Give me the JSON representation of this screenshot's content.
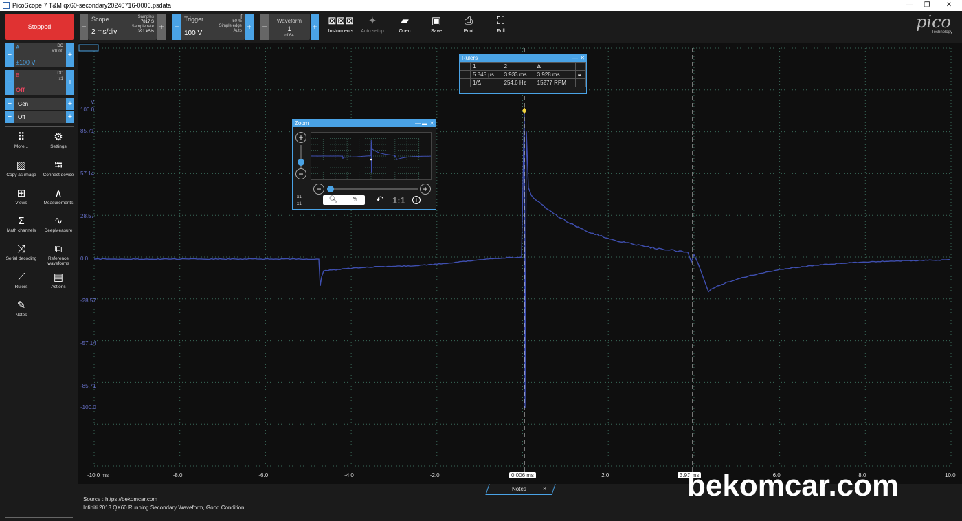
{
  "window": {
    "title": "PicoScope 7 T&M qx60-secondary20240716-0006.psdata"
  },
  "toolbar": {
    "run_state": "Stopped",
    "scope": {
      "label": "Scope",
      "timebase": "2 ms/div",
      "samples_label": "Samples",
      "samples_value": "7817 S",
      "rate_label": "Sample rate",
      "rate_value": "391 kS/s"
    },
    "trigger": {
      "label": "Trigger",
      "value": "100 V",
      "level": "50 %",
      "type": "Simple edge",
      "mode": "Auto"
    },
    "waveform": {
      "label": "Waveform",
      "index": "1",
      "of": "of 64"
    },
    "buttons": {
      "instruments": "Instruments",
      "auto_setup": "Auto setup",
      "open": "Open",
      "save": "Save",
      "print": "Print",
      "full": "Full"
    },
    "logo": "pico",
    "logo_sub": "Technology"
  },
  "channels": {
    "a": {
      "name": "A",
      "coupling": "DC",
      "probe": "x1000",
      "range": "±100 V"
    },
    "b": {
      "name": "B",
      "coupling": "DC",
      "probe": "x1",
      "state": "Off"
    },
    "gen": {
      "label": "Gen",
      "state": "Off"
    }
  },
  "sidebar": {
    "more": "More...",
    "settings": "Settings",
    "copy_image": "Copy as image",
    "connect": "Connect device",
    "views": "Views",
    "measurements": "Measurements",
    "math": "Math channels",
    "deep": "DeepMeasure",
    "serial": "Serial decoding",
    "reference": "Reference waveforms",
    "rulers": "Rulers",
    "actions": "Actions",
    "notes": "Notes"
  },
  "rulers": {
    "title": "Rulers",
    "headers": [
      "1",
      "2",
      "Δ"
    ],
    "values": [
      "5.845 µs",
      "3.933 ms",
      "3.928 ms"
    ],
    "inv_label": "1/Δ",
    "freq": "254.6 Hz",
    "rpm": "15277 RPM"
  },
  "zoom": {
    "title": "Zoom",
    "x1a": "x1",
    "x1b": "x1",
    "reset": "1:1"
  },
  "plot": {
    "y_unit": "V",
    "y_ticks": [
      "100.0",
      "85.71",
      "57.14",
      "28.57",
      "0.0",
      "-28.57",
      "-57.14",
      "-85.71",
      "-100.0"
    ],
    "x_ticks": [
      "-10.0 ms",
      "-8.0",
      "-6.0",
      "-4.0",
      "-2.0",
      "0.006 ms",
      "2.0",
      "3.93 ms",
      "6.0",
      "8.0",
      "10.0"
    ],
    "trace_color": "#3f4fb0"
  },
  "notes": {
    "tab": "Notes",
    "line1": "Source : https://bekomcar.com",
    "line2": "Infiniti 2013 QX60 Running Secondary Waveform, Good Condition"
  },
  "watermark": "bekomcar.com"
}
